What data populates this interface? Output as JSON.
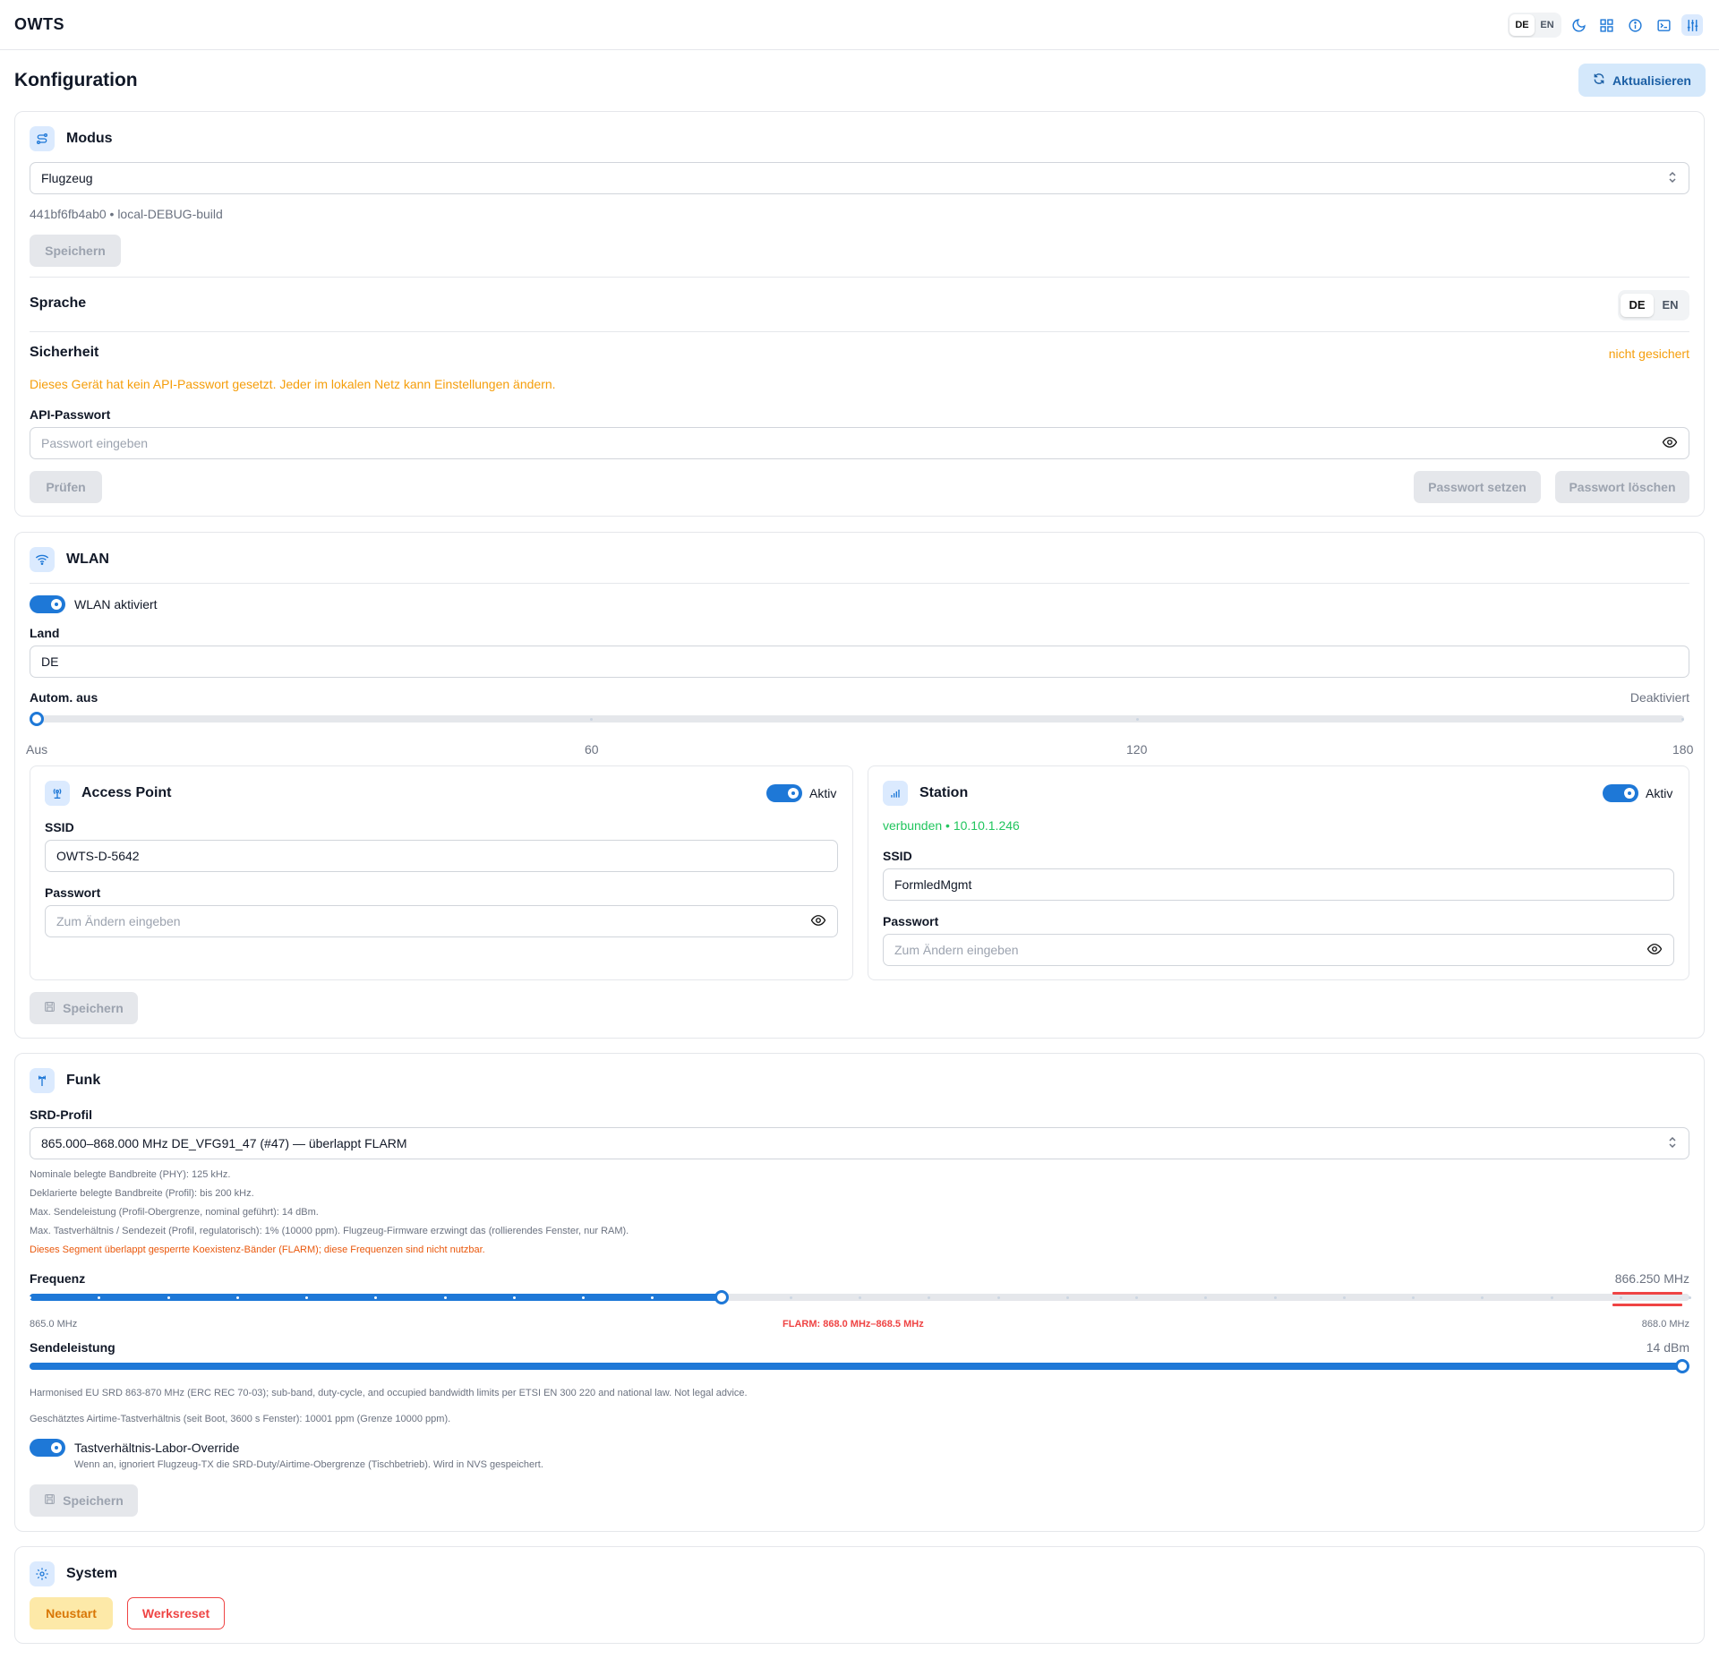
{
  "app": {
    "title": "OWTS"
  },
  "topbar": {
    "lang_options": [
      "DE",
      "EN"
    ],
    "icons": [
      "moon-icon",
      "grid-icon",
      "info-icon",
      "terminal-icon",
      "sliders-icon"
    ]
  },
  "page": {
    "title": "Konfiguration",
    "refresh_label": "Aktualisieren"
  },
  "modus": {
    "title": "Modus",
    "selected": "Flugzeug",
    "build_info": "441bf6fb4ab0 • local-DEBUG-build",
    "save_label": "Speichern"
  },
  "sprache": {
    "title": "Sprache",
    "options": [
      "DE",
      "EN"
    ],
    "selected": "DE"
  },
  "sicherheit": {
    "title": "Sicherheit",
    "status": "nicht gesichert",
    "warning": "Dieses Gerät hat kein API-Passwort gesetzt. Jeder im lokalen Netz kann Einstellungen ändern.",
    "password_label": "API-Passwort",
    "password_placeholder": "Passwort eingeben",
    "check_label": "Prüfen",
    "set_label": "Passwort setzen",
    "delete_label": "Passwort löschen"
  },
  "wlan": {
    "title": "WLAN",
    "enabled_label": "WLAN aktiviert",
    "enabled": true,
    "country_label": "Land",
    "country_value": "DE",
    "auto_off_label": "Autom. aus",
    "auto_off_value": "Deaktiviert",
    "auto_off_ticks": [
      "Aus",
      "60",
      "120",
      "180"
    ],
    "auto_off_level": 0,
    "access_point": {
      "title": "Access Point",
      "active_label": "Aktiv",
      "ssid_label": "SSID",
      "ssid_value": "OWTS-D-5642",
      "password_label": "Passwort",
      "password_placeholder": "Zum Ändern eingeben"
    },
    "station": {
      "title": "Station",
      "active_label": "Aktiv",
      "status": "verbunden • 10.10.1.246",
      "ssid_label": "SSID",
      "ssid_value": "FormledMgmt",
      "password_label": "Passwort",
      "password_placeholder": "Zum Ändern eingeben"
    },
    "save_label": "Speichern"
  },
  "funk": {
    "title": "Funk",
    "srd_label": "SRD-Profil",
    "srd_selected": "865.000–868.000 MHz DE_VFG91_47 (#47) — überlappt FLARM",
    "notes": [
      "Nominale belegte Bandbreite (PHY): 125 kHz.",
      "Deklarierte belegte Bandbreite (Profil): bis 200 kHz.",
      "Max. Sendeleistung (Profil-Obergrenze, nominal geführt): 14 dBm.",
      "Max. Tastverhältnis / Sendezeit (Profil, regulatorisch): 1% (10000 ppm). Flugzeug-Firmware erzwingt das (rollierendes Fenster, nur RAM)."
    ],
    "overlap_warning": "Dieses Segment überlappt gesperrte Koexistenz-Bänder (FLARM); diese Frequenzen sind nicht nutzbar.",
    "freq_label": "Frequenz",
    "freq_value": "866.250 MHz",
    "freq_min_label": "865.0 MHz",
    "freq_max_label": "868.0 MHz",
    "freq_min": 865.0,
    "freq_max": 868.0,
    "freq_current": 866.25,
    "flarm_label": "FLARM: 868.0 MHz–868.5 MHz",
    "power_label": "Sendeleistung",
    "power_value": "14 dBm",
    "power_level": 1.0,
    "legal_note": "Harmonised EU SRD 863-870 MHz (ERC REC 70-03); sub-band, duty-cycle, and occupied bandwidth limits per ETSI EN 300 220 and national law. Not legal advice.",
    "airtime_note": "Geschätztes Airtime-Tastverhältnis (seit Boot, 3600 s Fenster): 10001 ppm (Grenze 10000 ppm).",
    "override_label": "Tastverhältnis-Labor-Override",
    "override_enabled": true,
    "override_desc": "Wenn an, ignoriert Flugzeug-TX die SRD-Duty/Airtime-Obergrenze (Tischbetrieb). Wird in NVS gespeichert.",
    "save_label": "Speichern"
  },
  "system": {
    "title": "System",
    "restart_label": "Neustart",
    "reset_label": "Werksreset"
  },
  "colors": {
    "accent": "#1e78d7",
    "warning": "#f59e0b",
    "error": "#ef4444",
    "success": "#22c55e"
  }
}
